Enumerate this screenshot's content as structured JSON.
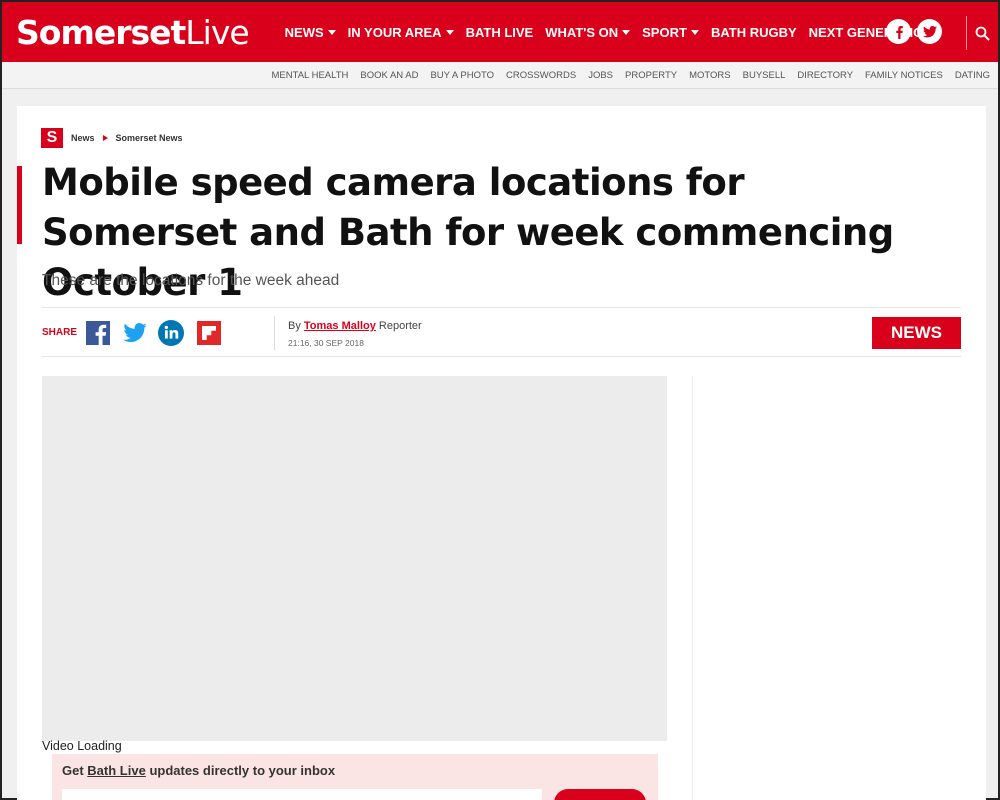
{
  "header": {
    "logo_bold": "Somerset",
    "logo_light": "Live",
    "nav": [
      {
        "label": "NEWS",
        "dropdown": true
      },
      {
        "label": "IN YOUR AREA",
        "dropdown": true
      },
      {
        "label": "BATH LIVE",
        "dropdown": false
      },
      {
        "label": "WHAT'S ON",
        "dropdown": true
      },
      {
        "label": "SPORT",
        "dropdown": true
      },
      {
        "label": "BATH RUGBY",
        "dropdown": false
      },
      {
        "label": "NEXT GENERATION",
        "dropdown": false
      }
    ],
    "social": [
      "facebook-icon",
      "twitter-icon"
    ],
    "search_icon": "search-icon"
  },
  "subnav": [
    "MENTAL HEALTH",
    "BOOK AN AD",
    "BUY A PHOTO",
    "CROSSWORDS",
    "JOBS",
    "PROPERTY",
    "MOTORS",
    "BUYSELL",
    "DIRECTORY",
    "FAMILY NOTICES",
    "DATING"
  ],
  "article": {
    "badge": "S",
    "breadcrumb": [
      "News",
      "Somerset News"
    ],
    "headline": "Mobile speed camera locations for Somerset and Bath for week commencing October 1",
    "standfirst": "These are the locations for the week ahead",
    "share_label": "SHARE",
    "share_icons": [
      "facebook-icon",
      "twitter-icon",
      "linkedin-icon",
      "flipboard-icon"
    ],
    "byline_prefix": "By",
    "author": "Tomas Malloy",
    "author_role": "Reporter",
    "timestamp": "21:16, 30 SEP 2018",
    "category_tag": "NEWS",
    "video_label": "Video Loading"
  },
  "newsletter": {
    "prefix": "Get",
    "link_text": "Bath Live",
    "suffix": "updates directly to your inbox"
  },
  "colors": {
    "brand_red": "#d9001b",
    "page_bg": "#f0f0f0"
  }
}
